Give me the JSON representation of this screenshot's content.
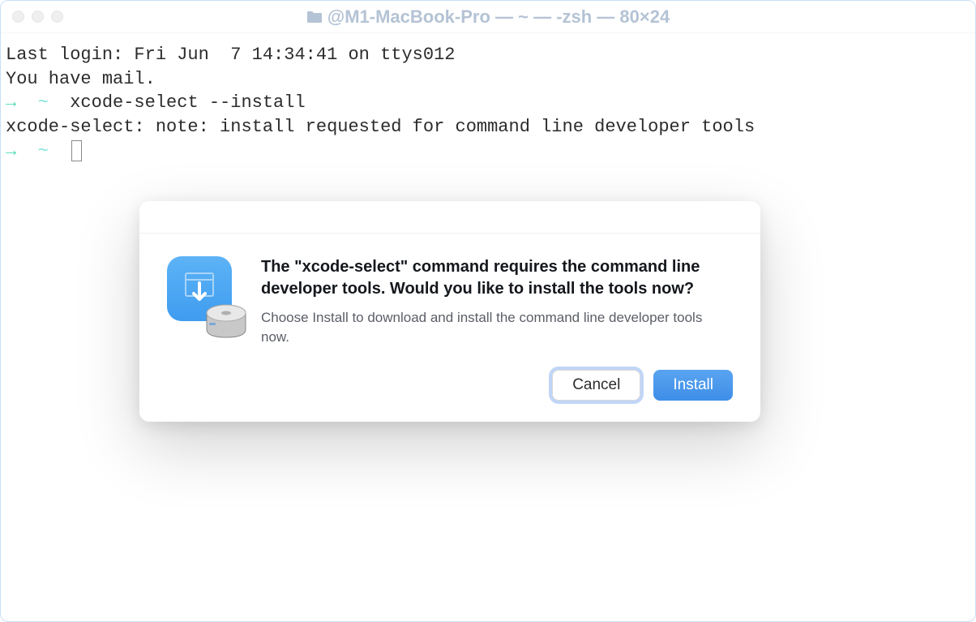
{
  "window": {
    "title": "@M1-MacBook-Pro — ~ — -zsh — 80×24"
  },
  "terminal": {
    "line1": "Last login: Fri Jun  7 14:34:41 on ttys012",
    "line2": "You have mail.",
    "prompt_arrow": "→",
    "prompt_tilde": "~",
    "command": "xcode-select --install",
    "blank": "",
    "output": "xcode-select: note: install requested for command line developer tools"
  },
  "dialog": {
    "title": "The \"xcode-select\" command requires the command line developer tools. Would you like to install the tools now?",
    "subtitle": "Choose Install to download and install the command line developer tools now.",
    "cancel_label": "Cancel",
    "install_label": "Install"
  }
}
